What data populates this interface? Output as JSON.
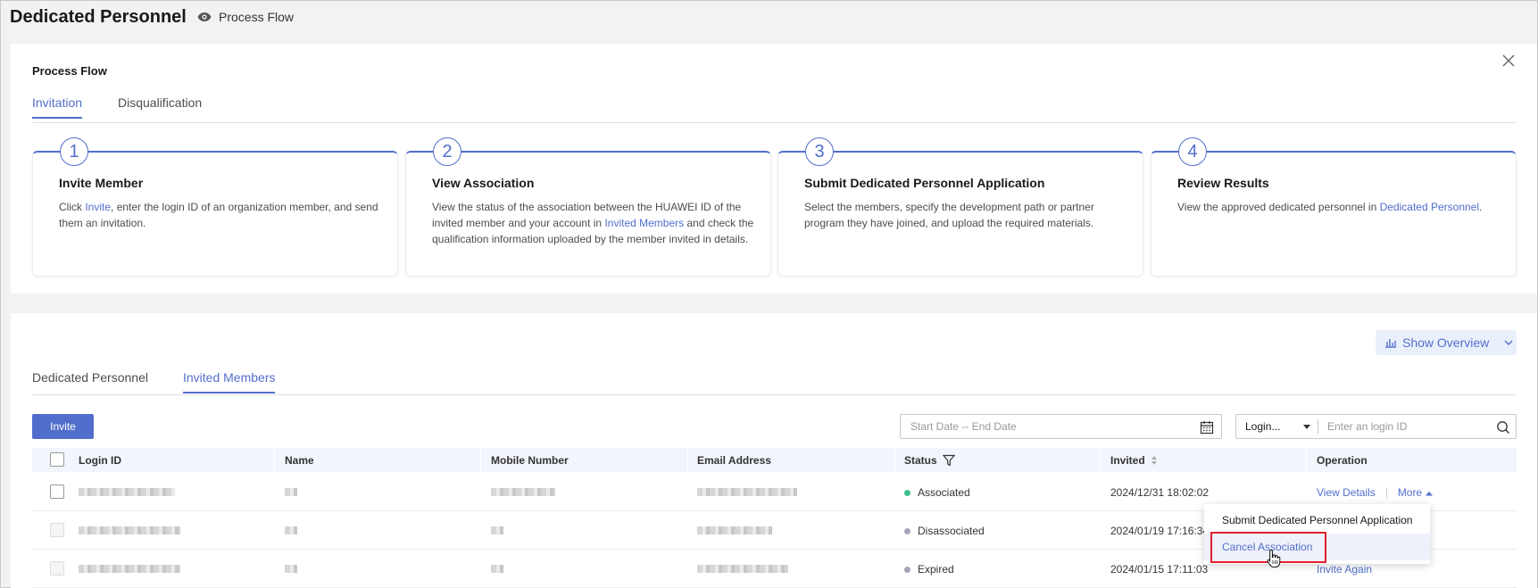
{
  "header": {
    "title": "Dedicated Personnel",
    "process_flow_link": "Process Flow"
  },
  "process_flow": {
    "title": "Process Flow",
    "tabs": [
      {
        "label": "Invitation",
        "active": true
      },
      {
        "label": "Disqualification",
        "active": false
      }
    ],
    "steps": [
      {
        "num": "1",
        "title": "Invite Member",
        "desc_before": "Click ",
        "desc_link": "Invite",
        "desc_after": ", enter the login ID of an organization member, and send them an invitation."
      },
      {
        "num": "2",
        "title": "View Association",
        "desc_before": "View the status of the association between the HUAWEI ID of the invited member and your account in ",
        "desc_link": "Invited Members",
        "desc_after": " and check the qualification information uploaded by the member invited in details."
      },
      {
        "num": "3",
        "title": "Submit Dedicated Personnel Application",
        "desc_before": "Select the members, specify the development path or partner program they have joined, and upload the required materials.",
        "desc_link": "",
        "desc_after": ""
      },
      {
        "num": "4",
        "title": "Review Results",
        "desc_before": "View the approved dedicated personnel in ",
        "desc_link": "Dedicated Personnel",
        "desc_after": "."
      }
    ]
  },
  "list": {
    "show_overview": "Show Overview",
    "tabs": [
      {
        "label": "Dedicated Personnel",
        "active": false
      },
      {
        "label": "Invited Members",
        "active": true
      }
    ],
    "invite_button": "Invite",
    "date_placeholder": "Start Date -- End Date",
    "login_select": "Login...",
    "login_placeholder": "Enter an login ID",
    "columns": [
      "Login ID",
      "Name",
      "Mobile Number",
      "Email Address",
      "Status",
      "Invited",
      "Operation"
    ],
    "rows": [
      {
        "status": "Associated",
        "status_color": "#3ac28a",
        "invited": "2024/12/31 18:02:02",
        "op1": "View Details",
        "op2": "More"
      },
      {
        "status": "Disassociated",
        "status_color": "#a7a4ba",
        "invited": "2024/01/19 17:16:34",
        "op1": "",
        "op2": ""
      },
      {
        "status": "Expired",
        "status_color": "#a7a4ba",
        "invited": "2024/01/15 17:11:03",
        "op1": "Invite Again",
        "op2": ""
      }
    ],
    "more_menu": [
      {
        "label": "Submit Dedicated Personnel Application"
      },
      {
        "label": "Cancel Association"
      }
    ]
  },
  "colors": {
    "accent": "#526ecc",
    "highlight_box": "#e0202a"
  }
}
